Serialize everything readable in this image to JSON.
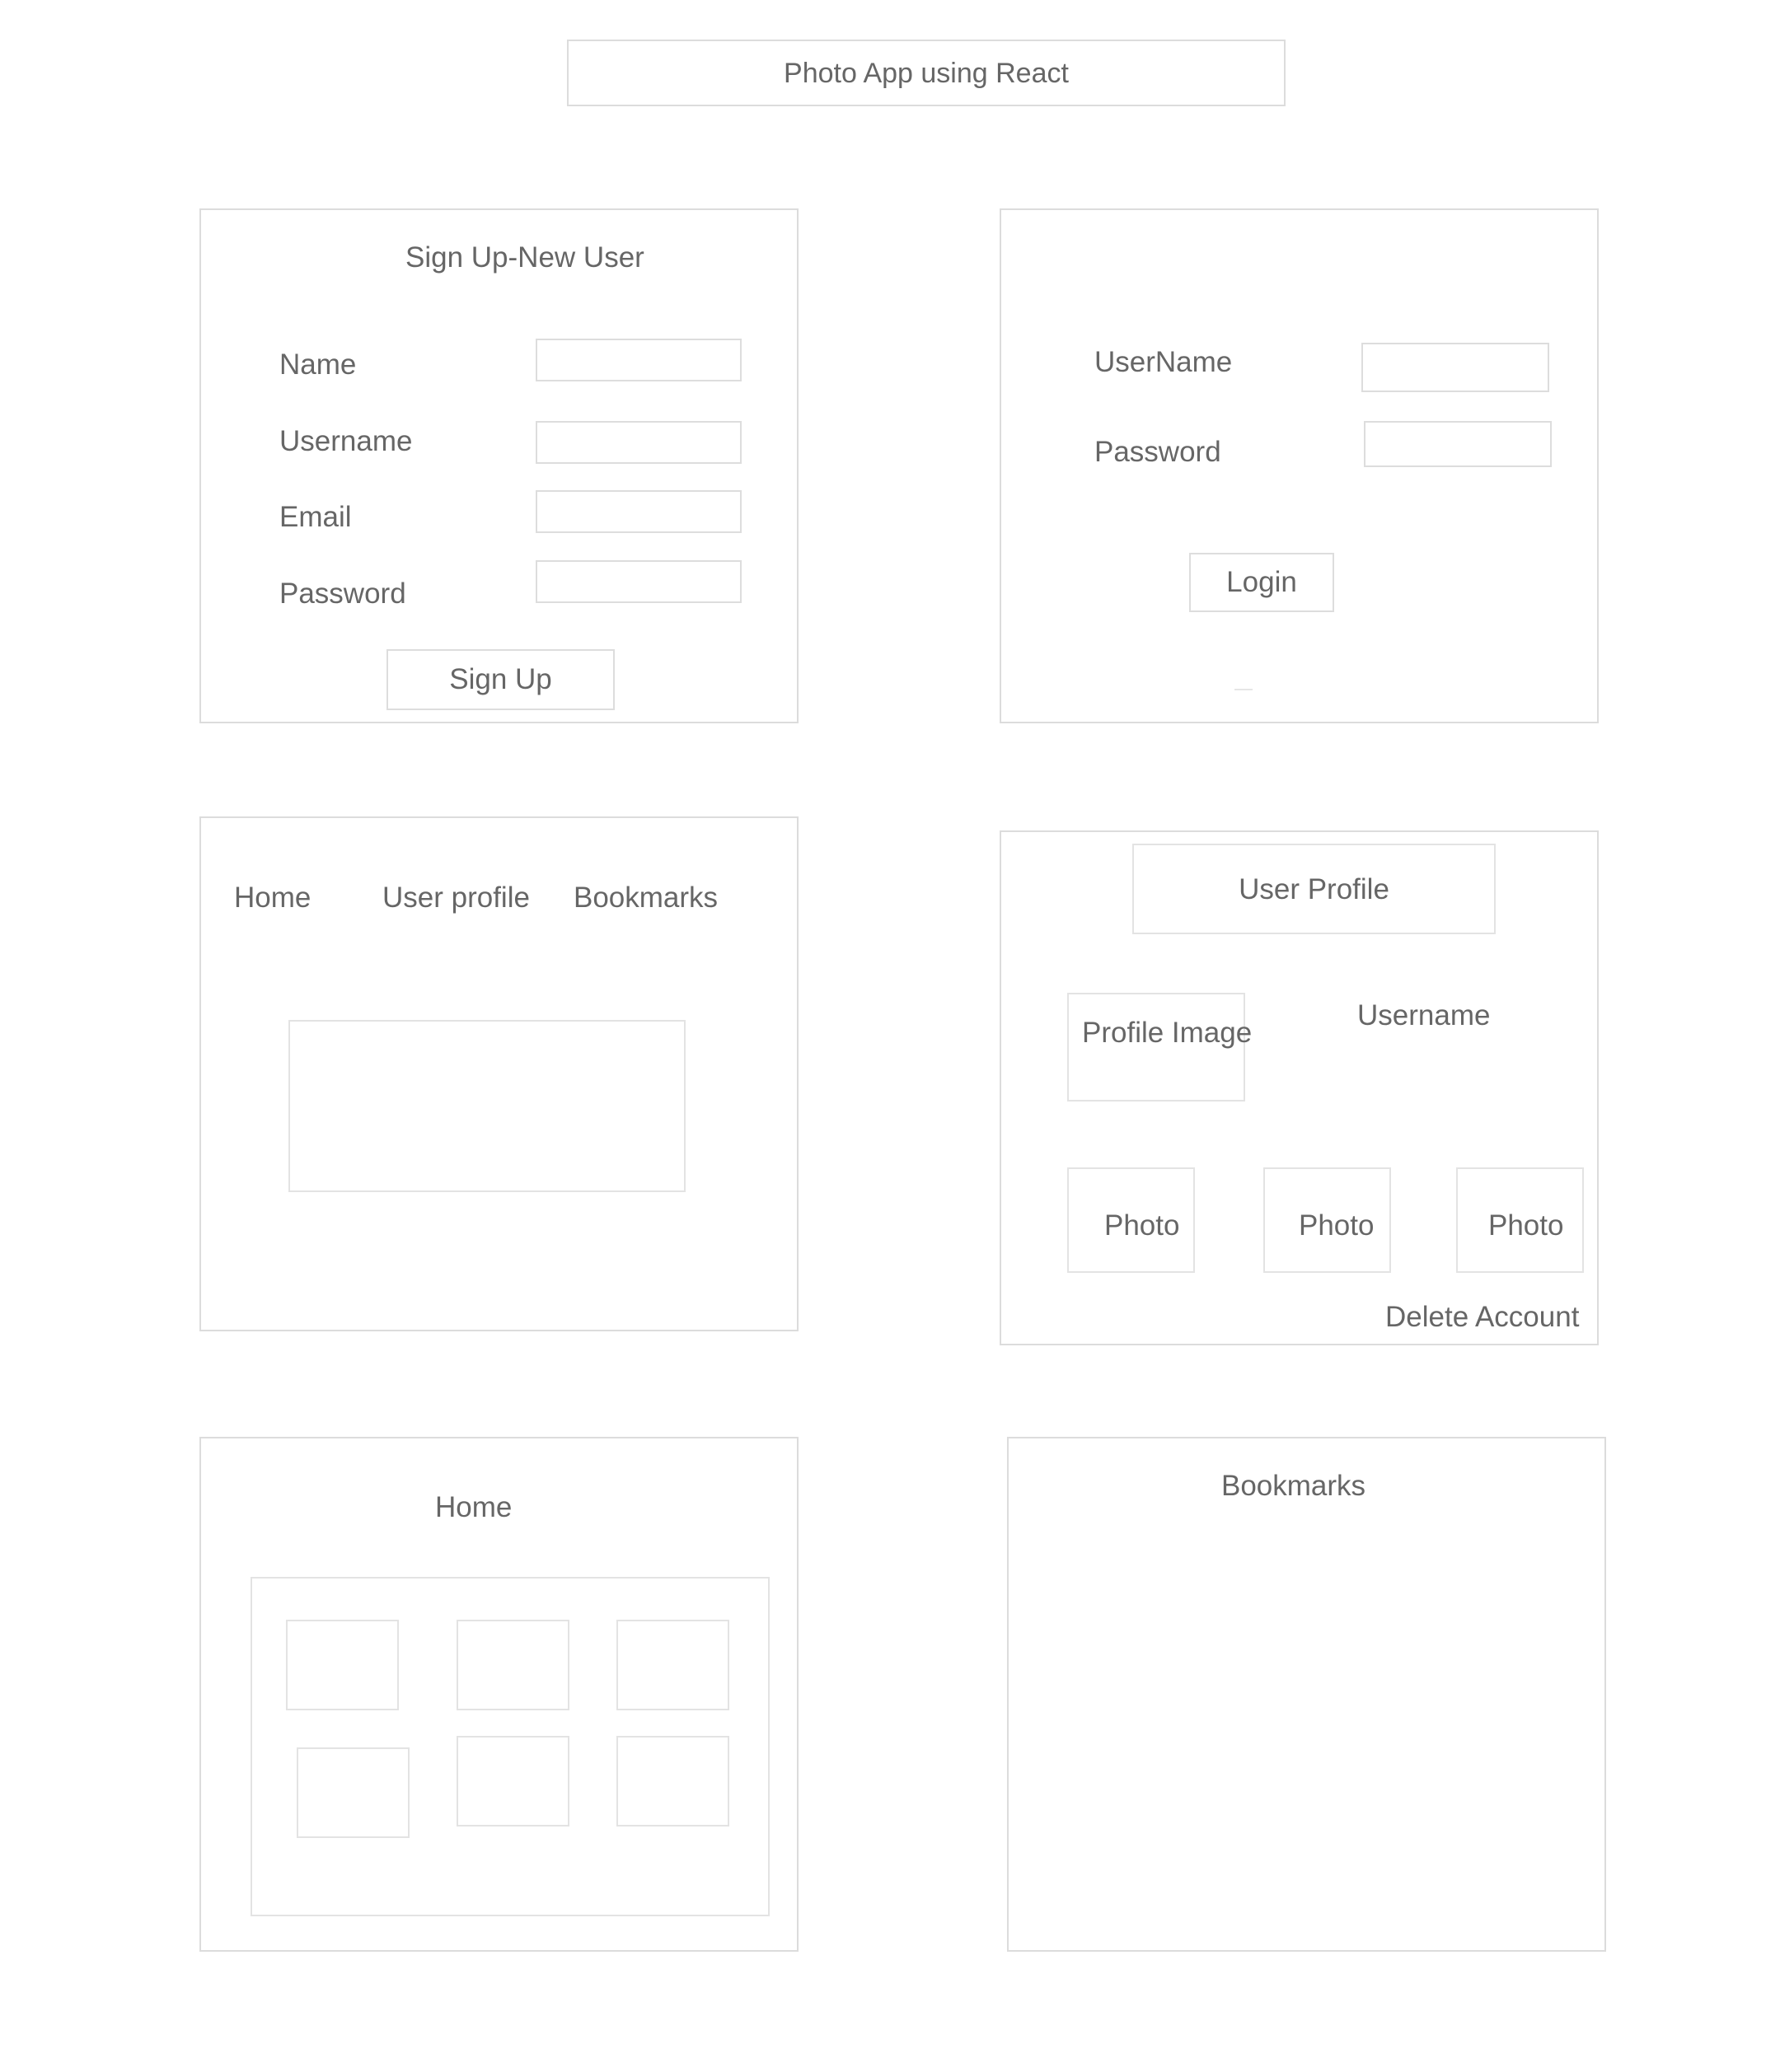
{
  "app_title": "Photo App using React",
  "signup": {
    "title": "Sign Up-New User",
    "fields": [
      {
        "label": "Name"
      },
      {
        "label": "Username"
      },
      {
        "label": "Email"
      },
      {
        "label": "Password"
      }
    ],
    "button": "Sign Up"
  },
  "login": {
    "fields": [
      {
        "label": "UserName"
      },
      {
        "label": "Password"
      }
    ],
    "button": "Login"
  },
  "nav": {
    "items": [
      "Home",
      "User profile",
      "Bookmarks"
    ]
  },
  "profile": {
    "title": "User Profile",
    "image_label": "Profile Image",
    "username": "Username",
    "photos": [
      "Photo",
      "Photo",
      "Photo"
    ],
    "delete": "Delete Account"
  },
  "home": {
    "title": "Home"
  },
  "bookmarks": {
    "title": "Bookmarks"
  }
}
